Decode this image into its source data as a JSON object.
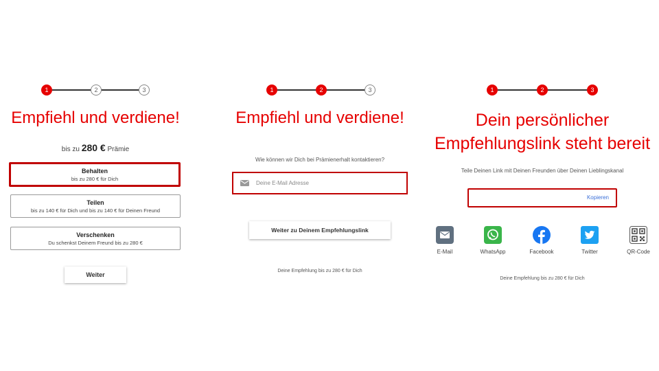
{
  "colors": {
    "brand_red": "#e60000",
    "border_red": "#c00000",
    "link_blue": "#3a6fd8"
  },
  "panel1": {
    "steps": [
      "1",
      "2",
      "3"
    ],
    "headline": "Empfiehl und verdiene!",
    "prize_prefix": "bis zu",
    "prize_amount": "280 €",
    "prize_suffix": "Prämie",
    "options": [
      {
        "title": "Behalten",
        "subtitle": "bis zu 280 € für Dich"
      },
      {
        "title": "Teilen",
        "subtitle": "bis zu 140 € für Dich und bis zu 140 € für Deinen Freund"
      },
      {
        "title": "Verschenken",
        "subtitle": "Du schenkst Deinem Freund bis zu 280 €"
      }
    ],
    "next_label": "Weiter"
  },
  "panel2": {
    "steps": [
      "1",
      "2",
      "3"
    ],
    "headline": "Empfiehl und verdiene!",
    "contact_question": "Wie können wir Dich bei Prämienerhalt kontaktieren?",
    "email_placeholder": "Deine E-Mail Adresse",
    "continue_label": "Weiter zu Deinem Empfehlungslink",
    "footer_note": "Deine Empfehlung bis zu 280 € für Dich"
  },
  "panel3": {
    "steps": [
      "1",
      "2",
      "3"
    ],
    "headline_line1": "Dein persönlicher",
    "headline_line2": "Empfehlungslink steht bereit",
    "share_prompt": "Teile Deinen Link mit Deinen Freunden über Deinen Lieblingskanal",
    "copy_label": "Kopieren",
    "share_options": [
      {
        "label": "E-Mail",
        "icon": "email-icon",
        "color": "#607080"
      },
      {
        "label": "WhatsApp",
        "icon": "whatsapp-icon",
        "color": "#3ab54a"
      },
      {
        "label": "Facebook",
        "icon": "facebook-icon",
        "color": "#1877f2"
      },
      {
        "label": "Twitter",
        "icon": "twitter-icon",
        "color": "#1da1f2"
      },
      {
        "label": "QR-Code",
        "icon": "qr-code-icon",
        "color": "#555555"
      }
    ],
    "footer_note": "Deine Empfehlung bis zu 280 € für Dich"
  }
}
